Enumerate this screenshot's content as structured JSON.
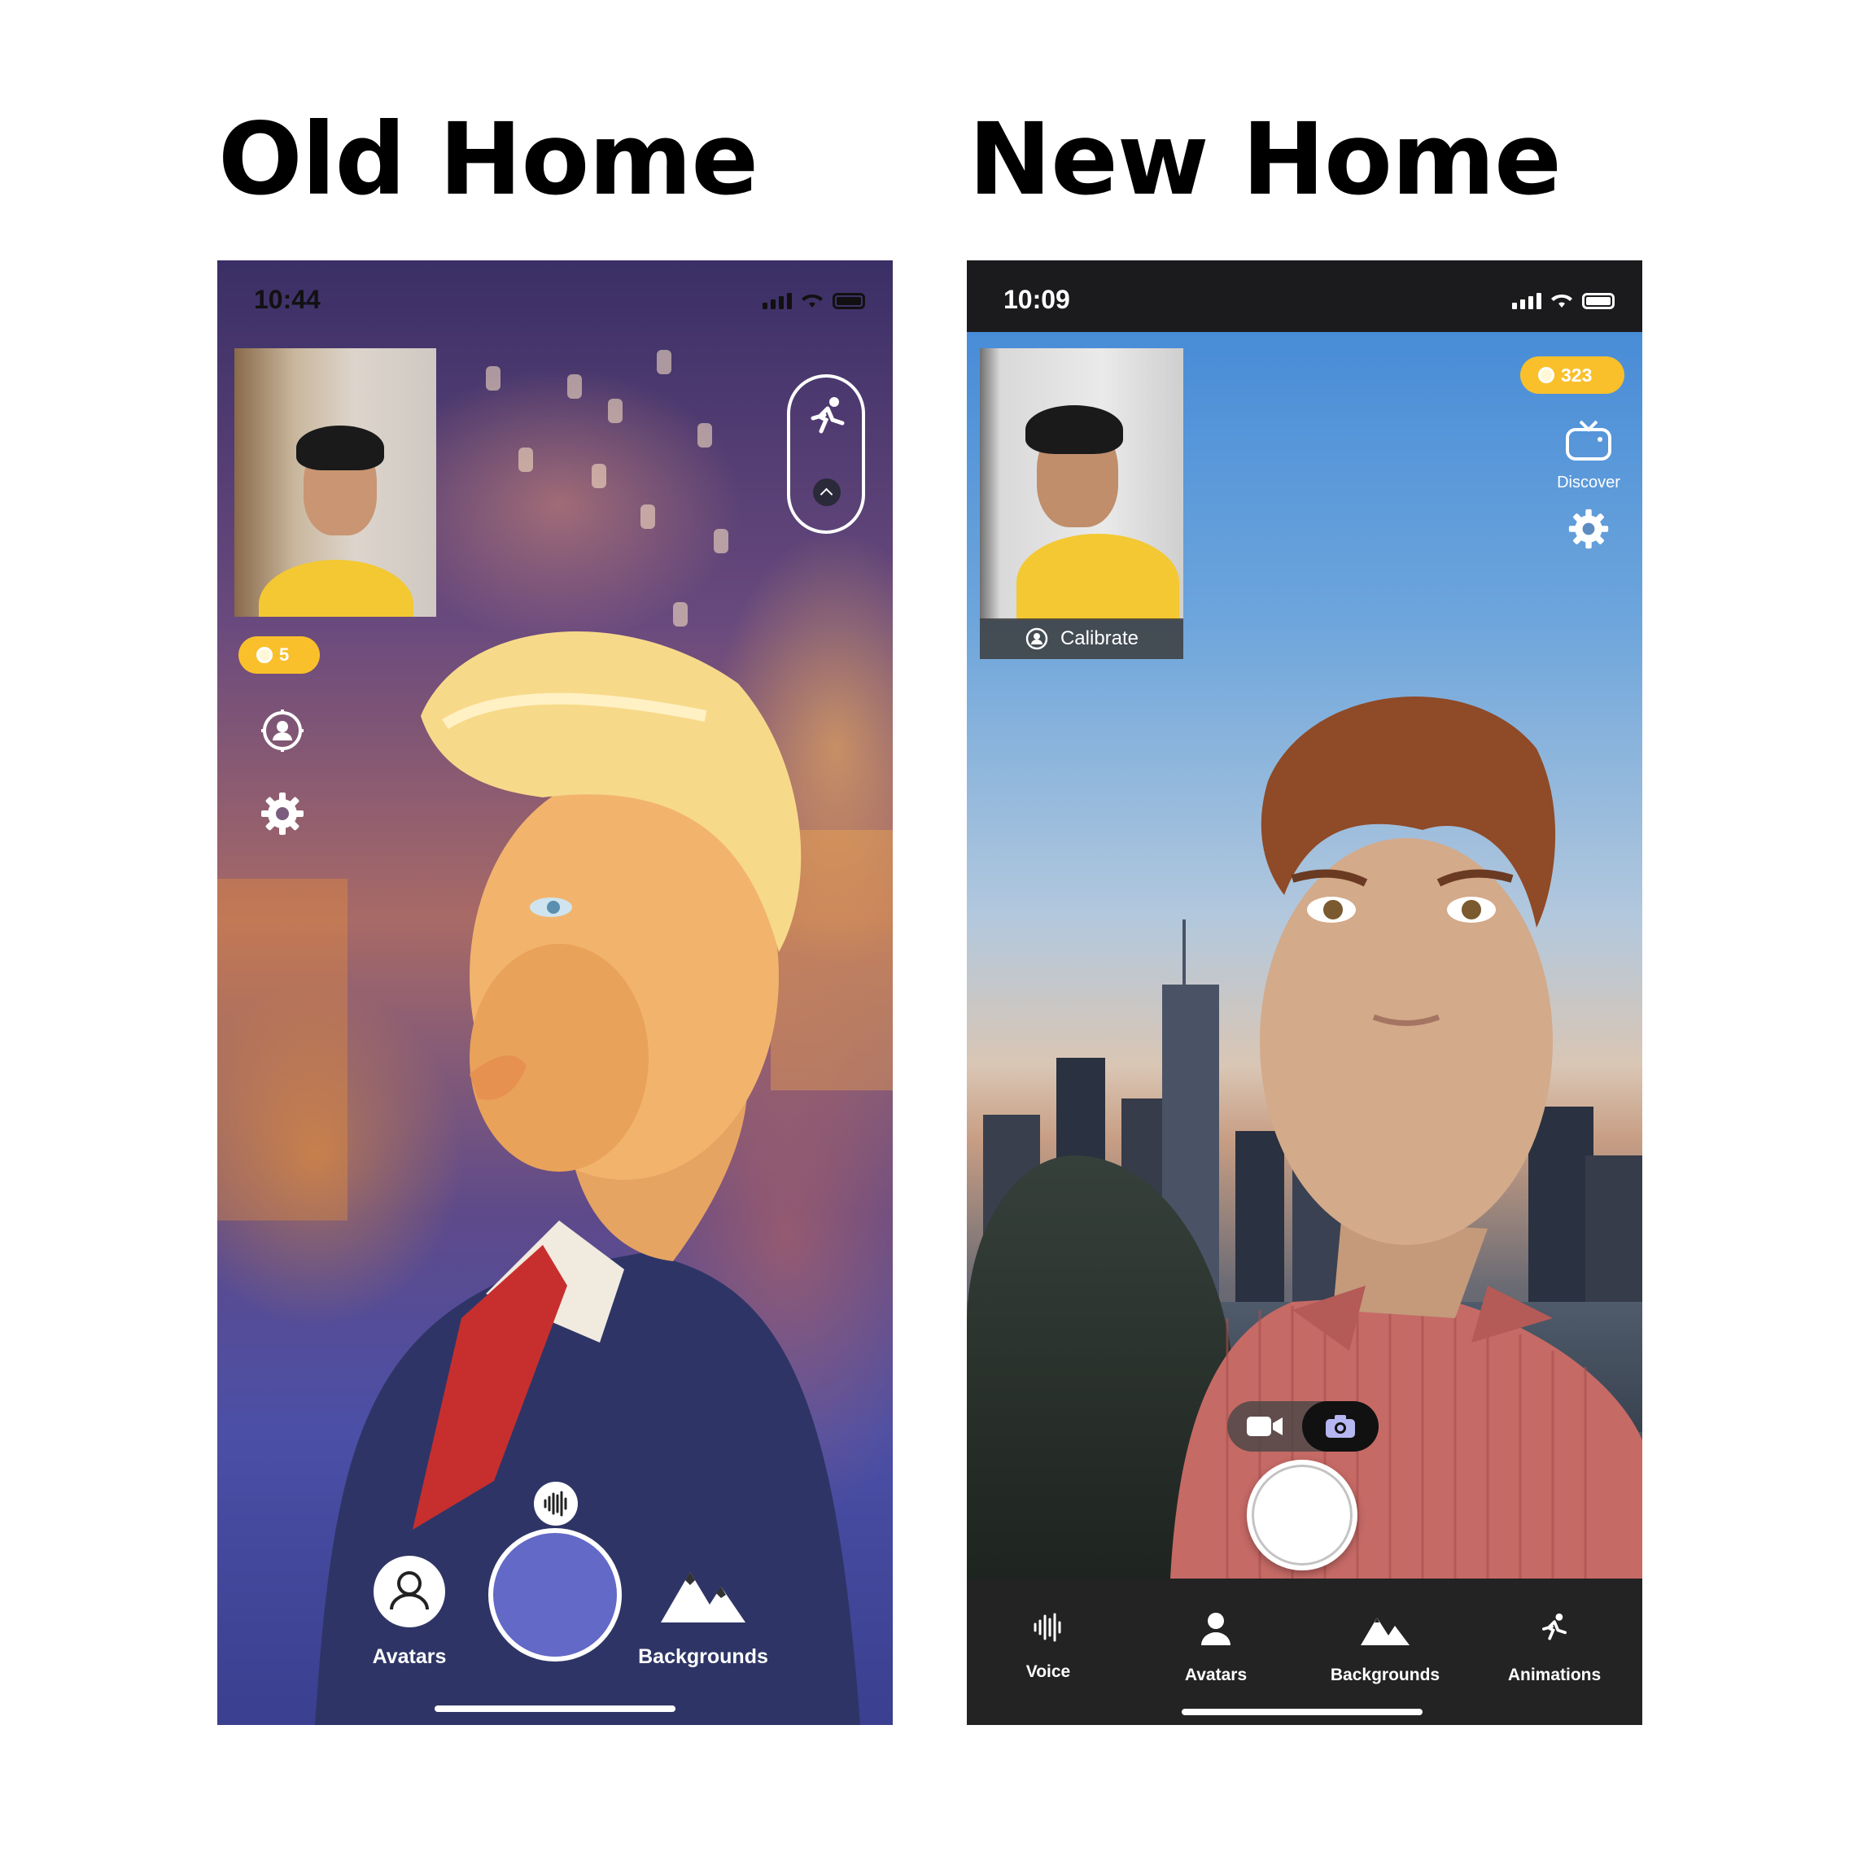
{
  "headings": {
    "old": "Old Home",
    "new": "New Home"
  },
  "old_screen": {
    "status": {
      "time": "10:44"
    },
    "coins": "5",
    "icons": [
      "running-figure-icon",
      "chevron-up-icon",
      "calibrate-icon",
      "gear-icon",
      "voice-waveform-icon",
      "person-icon",
      "mountains-icon"
    ],
    "labels": {
      "avatars": "Avatars",
      "backgrounds": "Backgrounds"
    },
    "record_button_color": "#6369c7"
  },
  "new_screen": {
    "status": {
      "time": "10:09"
    },
    "coins": "323",
    "discover": "Discover",
    "calibrate": "Calibrate",
    "tabs": [
      {
        "label": "Voice",
        "icon": "voice-waveform-icon"
      },
      {
        "label": "Avatars",
        "icon": "person-icon"
      },
      {
        "label": "Backgrounds",
        "icon": "mountains-icon"
      },
      {
        "label": "Animations",
        "icon": "running-figure-icon"
      }
    ],
    "colors": {
      "coin_pill": "#f9c02b",
      "tab_bar": "#232323"
    }
  }
}
